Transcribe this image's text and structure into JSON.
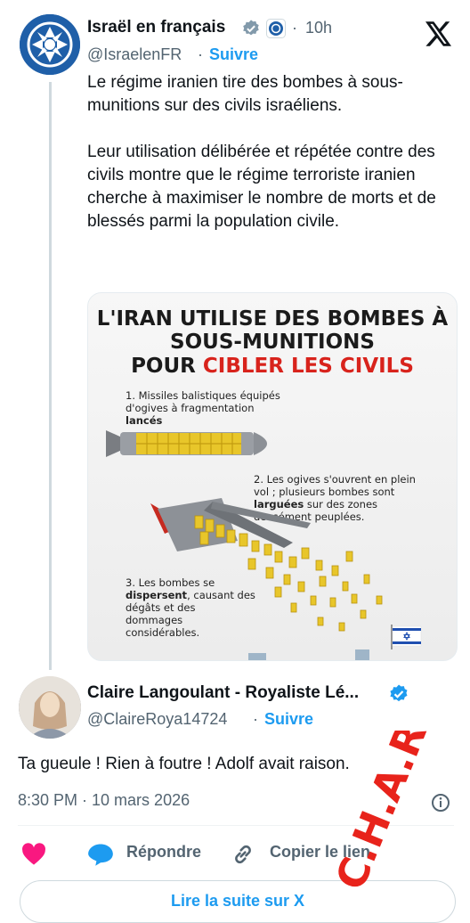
{
  "tweet": {
    "author_name": "Israël en français",
    "handle": "@IsraelenFR",
    "time_ago": "10h",
    "separator": "·",
    "follow_label": "Suivre",
    "paragraph_1": "Le régime iranien tire des bombes à sous-munitions sur des civils israéliens.",
    "paragraph_2": "Leur utilisation délibérée et répétée contre des civils montre que le régime terroriste iranien cherche à maximiser le nombre de morts et de blessés parmi la population civile."
  },
  "infographic": {
    "title_line_1": "L'IRAN UTILISE DES BOMBES À",
    "title_line_2": "SOUS-MUNITIONS",
    "title_line_3_a": "POUR ",
    "title_line_3_b": "CIBLER LES CIVILS",
    "step_1_a": "1. Missiles balistiques équipés",
    "step_1_b": "d'ogives à fragmentation",
    "step_1_c": "lancés",
    "step_2_a": "2. Les ogives s'ouvrent en plein",
    "step_2_b": "vol ; plusieurs bombes sont",
    "step_2_c": "larguées",
    "step_2_d": " sur des zones",
    "step_2_e": "densément peuplées.",
    "step_3_a": "3. Les bombes se",
    "step_3_b": "dispersent",
    "step_3_c": ", causant des",
    "step_3_d": "dégâts et des",
    "step_3_e": "dommages",
    "step_3_f": "considérables."
  },
  "reply": {
    "author_name": "Claire Langoulant - Royaliste Lé...",
    "handle": "@ClaireRoya14724",
    "separator": "·",
    "follow_label": "Suivre",
    "text": "Ta gueule ! Rien à foutre ! Adolf avait raison.",
    "timestamp": "8:30 PM · 10 mars 2026"
  },
  "actions": {
    "reply_label": "Répondre",
    "copy_link_label": "Copier le lien",
    "read_more_label": "Lire la suite sur X"
  },
  "watermark": "C.H.A.R.",
  "colors": {
    "accent": "#1d9bf0",
    "heart": "#f91880",
    "watermark": "#e8231b",
    "infographic_red": "#d8231c"
  }
}
